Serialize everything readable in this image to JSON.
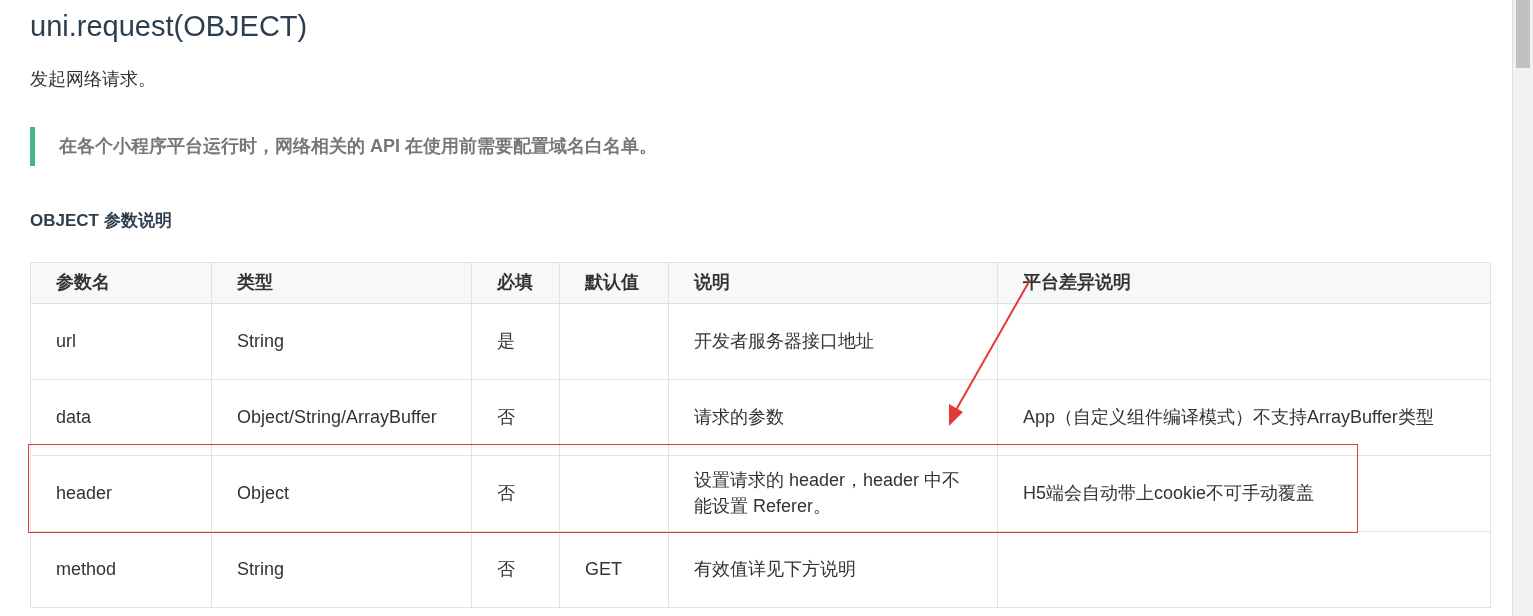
{
  "title": "uni.request(OBJECT)",
  "description": "发起网络请求。",
  "tip": "在各个小程序平台运行时，网络相关的 API 在使用前需要配置域名白名单。",
  "section_title": "OBJECT 参数说明",
  "table": {
    "columns": [
      "参数名",
      "类型",
      "必填",
      "默认值",
      "说明",
      "平台差异说明"
    ],
    "rows": [
      [
        "url",
        "String",
        "是",
        "",
        "开发者服务器接口地址",
        ""
      ],
      [
        "data",
        "Object/String/ArrayBuffer",
        "否",
        "",
        "请求的参数",
        "App（自定义组件编译模式）不支持ArrayBuffer类型"
      ],
      [
        "header",
        "Object",
        "否",
        "",
        "设置请求的 header，header 中不能设置 Referer。",
        "H5端会自动带上cookie不可手动覆盖"
      ],
      [
        "method",
        "String",
        "否",
        "GET",
        "有效值详见下方说明",
        ""
      ]
    ]
  }
}
